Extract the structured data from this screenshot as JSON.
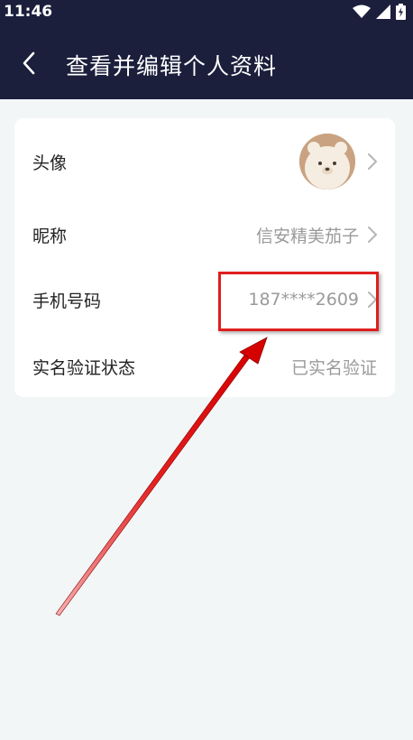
{
  "status_bar": {
    "time": "11:46",
    "icons": [
      "wifi-icon",
      "signal-icon",
      "battery-charging-icon"
    ]
  },
  "header": {
    "back_icon": "chevron-left-icon",
    "title": "查看并编辑个人资料"
  },
  "profile": {
    "avatar": {
      "label": "头像",
      "icon": "bear-avatar"
    },
    "nickname": {
      "label": "昵称",
      "value": "信安精美茄子"
    },
    "phone": {
      "label": "手机号码",
      "value": "187****2609"
    },
    "verification": {
      "label": "实名验证状态",
      "value": "已实名验证"
    }
  },
  "colors": {
    "header_bg": "#1b1f3b",
    "page_bg": "#f2f6f7",
    "highlight": "#e01e1e",
    "value_text": "#9a9a9a"
  }
}
